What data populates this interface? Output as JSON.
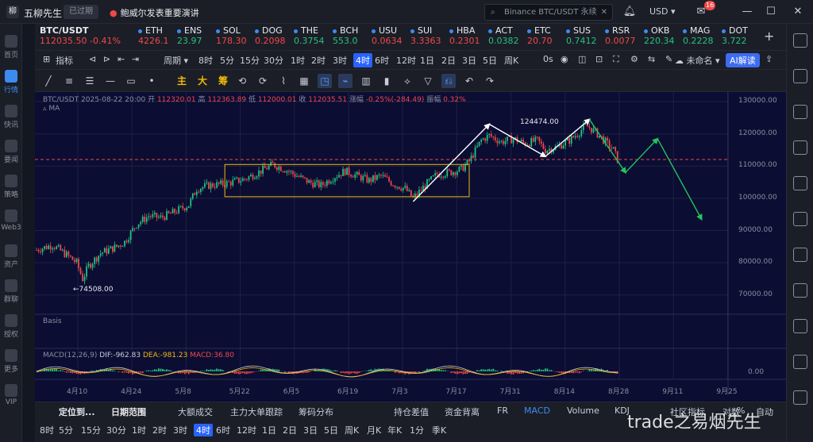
{
  "titlebar": {
    "app_name": "五柳先生",
    "badge": "已过期",
    "news": "鲍威尔发表重要演讲",
    "search_value": "Binance BTC/USDT 永续",
    "currency": "USD",
    "notify_count": "16"
  },
  "sidebar": {
    "items": [
      {
        "label": "首页"
      },
      {
        "label": "行情"
      },
      {
        "label": "快讯"
      },
      {
        "label": "要闻"
      },
      {
        "label": "策略"
      },
      {
        "label": "Web3"
      },
      {
        "label": "资产"
      },
      {
        "label": "群聊"
      },
      {
        "label": "授权"
      },
      {
        "label": "更多"
      },
      {
        "label": "VIP"
      }
    ]
  },
  "tickers": {
    "main": {
      "name": "BTC/USDT",
      "price": "112035.50",
      "change": "-0.41%"
    },
    "items": [
      {
        "name": "ETH",
        "price": "4226.1",
        "dir": "dn"
      },
      {
        "name": "ENS",
        "price": "23.97",
        "dir": "up"
      },
      {
        "name": "SOL",
        "price": "178.30",
        "dir": "dn"
      },
      {
        "name": "DOG",
        "price": "0.2098",
        "dir": "dn"
      },
      {
        "name": "THE",
        "price": "0.3754",
        "dir": "up"
      },
      {
        "name": "BCH",
        "price": "553.0",
        "dir": "up"
      },
      {
        "name": "USU",
        "price": "0.0634",
        "dir": "dn"
      },
      {
        "name": "SUI",
        "price": "3.3363",
        "dir": "dn"
      },
      {
        "name": "HBA",
        "price": "0.2301",
        "dir": "dn"
      },
      {
        "name": "ACT",
        "price": "0.0382",
        "dir": "up"
      },
      {
        "name": "ETC",
        "price": "20.70",
        "dir": "dn"
      },
      {
        "name": "SUS",
        "price": "0.7412",
        "dir": "up"
      },
      {
        "name": "RSR",
        "price": "0.0077",
        "dir": "dn"
      },
      {
        "name": "OKB",
        "price": "220.34",
        "dir": "up"
      },
      {
        "name": "MAG",
        "price": "0.2228",
        "dir": "up"
      },
      {
        "name": "DOT",
        "price": "3.722",
        "dir": "up"
      }
    ]
  },
  "toolbar1": {
    "indicator": "指标",
    "period": "周期",
    "timeframes": [
      "8时",
      "5分",
      "15分",
      "30分",
      "1时",
      "2时",
      "3时",
      "4时",
      "6时",
      "12时",
      "1日",
      "2日",
      "3日",
      "5日",
      "周K"
    ],
    "active_tf": "4时",
    "countdown": "0s",
    "unnamed": "未命名",
    "ai": "AI解读"
  },
  "toolbar2": {
    "gold_tools": [
      "主",
      "大",
      "筹"
    ]
  },
  "chart": {
    "info": {
      "symbol": "BTC/USDT",
      "datetime": "2025-08-22 20:00",
      "open_label": "开",
      "open": "112320.01",
      "high_label": "高",
      "high": "112363.89",
      "low_label": "低",
      "low": "112000.01",
      "close_label": "收",
      "close": "112035.51",
      "chg_label": "涨幅",
      "chg": "-0.25%(-284.49)",
      "amp_label": "振幅",
      "amp": "0.32%"
    },
    "ma_label": "MA",
    "basis_label": "Basis",
    "macd": {
      "label": "MACD(12,26,9)",
      "dif": "DIF:-962.83",
      "dea": "DEA:-981.23",
      "macd": "MACD:36.80"
    },
    "price_labels": {
      "low": "74508.00",
      "high": "124474.00"
    },
    "colors": {
      "up": "#26c281",
      "down": "#f04848",
      "box": "#f0b90b",
      "arrow_white": "#ffffff",
      "arrow_green": "#22c55e",
      "dash": "#f04848"
    }
  },
  "chart_data": {
    "type": "candlestick",
    "title": "BTC/USDT",
    "yticks": [
      130000,
      120000,
      110000,
      100000,
      90000,
      80000,
      70000
    ],
    "ytick_labels": [
      "130000.00",
      "120000.00",
      "110000.00",
      "100000.00",
      "90000.00",
      "80000.00",
      "70000.00"
    ],
    "ylim": [
      65000,
      132000
    ],
    "macd_tick": "0.00",
    "x_labels": [
      "4月10",
      "4月24",
      "5月8",
      "5月22",
      "6月5",
      "6月19",
      "7月3",
      "7月17",
      "7月31",
      "8月14",
      "8月28",
      "9月11",
      "9月25"
    ],
    "current_price": 112035.5,
    "price_path": [
      [
        0,
        84000
      ],
      [
        4,
        85500
      ],
      [
        8,
        82000
      ],
      [
        10,
        80000
      ],
      [
        11.5,
        75000
      ],
      [
        13,
        79000
      ],
      [
        16,
        83000
      ],
      [
        20,
        85000
      ],
      [
        22,
        86500
      ],
      [
        25,
        92000
      ],
      [
        28,
        94500
      ],
      [
        31,
        94000
      ],
      [
        34,
        95500
      ],
      [
        38,
        98000
      ],
      [
        40,
        103000
      ],
      [
        43,
        104000
      ],
      [
        47,
        104500
      ],
      [
        52,
        106000
      ],
      [
        56,
        108500
      ],
      [
        59,
        110500
      ],
      [
        62,
        109000
      ],
      [
        65,
        107000
      ],
      [
        68,
        105000
      ],
      [
        71,
        104000
      ],
      [
        74,
        106500
      ],
      [
        77,
        108500
      ],
      [
        80,
        107000
      ],
      [
        83,
        105500
      ],
      [
        86,
        107000
      ],
      [
        89,
        104500
      ],
      [
        92,
        103000
      ],
      [
        94,
        100000
      ],
      [
        97,
        104000
      ],
      [
        100,
        107500
      ],
      [
        103,
        108000
      ],
      [
        106,
        109000
      ],
      [
        108,
        111500
      ],
      [
        111,
        118000
      ],
      [
        113,
        119500
      ],
      [
        116,
        117500
      ],
      [
        119,
        118500
      ],
      [
        122,
        117000
      ],
      [
        125,
        118000
      ],
      [
        127,
        115000
      ],
      [
        130,
        116000
      ],
      [
        133,
        118000
      ],
      [
        135,
        120000
      ],
      [
        137,
        122500
      ],
      [
        138,
        122000
      ],
      [
        140,
        120000
      ],
      [
        142,
        117500
      ],
      [
        144,
        115000
      ],
      [
        145,
        112035
      ]
    ],
    "range_box": {
      "x0": 47,
      "x1": 108,
      "y0": 110500,
      "y1": 100500
    },
    "wave_white": [
      [
        94,
        99000
      ],
      [
        113,
        123000
      ],
      [
        127,
        113000
      ],
      [
        138,
        124474
      ]
    ],
    "wave_green": [
      [
        138,
        124474
      ],
      [
        147,
        108000
      ],
      [
        155,
        118500
      ],
      [
        166,
        93500
      ]
    ]
  },
  "bottombar": {
    "items": [
      "定位到...",
      "日期范围",
      "大额成交",
      "主力大单跟踪",
      "筹码分布",
      "持仓差值",
      "资金背离",
      "FR",
      "MACD",
      "Volume",
      "KDJ",
      "社区指标",
      "对数",
      "%",
      "自动"
    ]
  },
  "periodbar": {
    "items": [
      "8时",
      "5分",
      "15分",
      "30分",
      "1时",
      "2时",
      "3时",
      "4时",
      "6时",
      "12时",
      "1日",
      "2日",
      "3日",
      "5日",
      "周K",
      "月K",
      "年K",
      "1分",
      "季K"
    ],
    "active": "4时"
  },
  "watermark": "trade之易烟先生"
}
